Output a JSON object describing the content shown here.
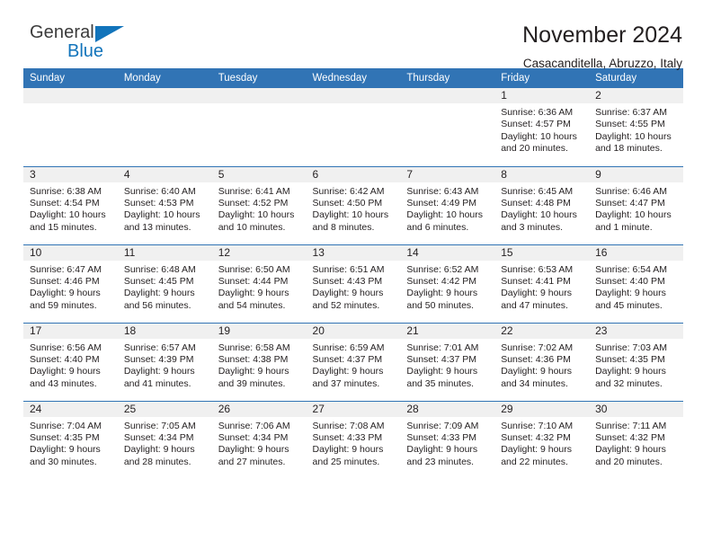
{
  "logo": {
    "word1": "General",
    "word2": "Blue",
    "triangle_icon": "blue-triangle-icon",
    "accent_color": "#1274bb"
  },
  "header": {
    "title": "November 2024",
    "subtitle": "Casacanditella, Abruzzo, Italy"
  },
  "colors": {
    "header_blue": "#3174b5",
    "daynum_bg": "#f0f0f0",
    "text": "#231f20"
  },
  "weekday_headers": [
    "Sunday",
    "Monday",
    "Tuesday",
    "Wednesday",
    "Thursday",
    "Friday",
    "Saturday"
  ],
  "weeks": [
    [
      {
        "day": "",
        "empty": true,
        "sunrise": "",
        "sunset": "",
        "daylight1": "",
        "daylight2": ""
      },
      {
        "day": "",
        "empty": true,
        "sunrise": "",
        "sunset": "",
        "daylight1": "",
        "daylight2": ""
      },
      {
        "day": "",
        "empty": true,
        "sunrise": "",
        "sunset": "",
        "daylight1": "",
        "daylight2": ""
      },
      {
        "day": "",
        "empty": true,
        "sunrise": "",
        "sunset": "",
        "daylight1": "",
        "daylight2": ""
      },
      {
        "day": "",
        "empty": true,
        "sunrise": "",
        "sunset": "",
        "daylight1": "",
        "daylight2": ""
      },
      {
        "day": "1",
        "empty": false,
        "sunrise": "Sunrise: 6:36 AM",
        "sunset": "Sunset: 4:57 PM",
        "daylight1": "Daylight: 10 hours",
        "daylight2": "and 20 minutes."
      },
      {
        "day": "2",
        "empty": false,
        "sunrise": "Sunrise: 6:37 AM",
        "sunset": "Sunset: 4:55 PM",
        "daylight1": "Daylight: 10 hours",
        "daylight2": "and 18 minutes."
      }
    ],
    [
      {
        "day": "3",
        "empty": false,
        "sunrise": "Sunrise: 6:38 AM",
        "sunset": "Sunset: 4:54 PM",
        "daylight1": "Daylight: 10 hours",
        "daylight2": "and 15 minutes."
      },
      {
        "day": "4",
        "empty": false,
        "sunrise": "Sunrise: 6:40 AM",
        "sunset": "Sunset: 4:53 PM",
        "daylight1": "Daylight: 10 hours",
        "daylight2": "and 13 minutes."
      },
      {
        "day": "5",
        "empty": false,
        "sunrise": "Sunrise: 6:41 AM",
        "sunset": "Sunset: 4:52 PM",
        "daylight1": "Daylight: 10 hours",
        "daylight2": "and 10 minutes."
      },
      {
        "day": "6",
        "empty": false,
        "sunrise": "Sunrise: 6:42 AM",
        "sunset": "Sunset: 4:50 PM",
        "daylight1": "Daylight: 10 hours",
        "daylight2": "and 8 minutes."
      },
      {
        "day": "7",
        "empty": false,
        "sunrise": "Sunrise: 6:43 AM",
        "sunset": "Sunset: 4:49 PM",
        "daylight1": "Daylight: 10 hours",
        "daylight2": "and 6 minutes."
      },
      {
        "day": "8",
        "empty": false,
        "sunrise": "Sunrise: 6:45 AM",
        "sunset": "Sunset: 4:48 PM",
        "daylight1": "Daylight: 10 hours",
        "daylight2": "and 3 minutes."
      },
      {
        "day": "9",
        "empty": false,
        "sunrise": "Sunrise: 6:46 AM",
        "sunset": "Sunset: 4:47 PM",
        "daylight1": "Daylight: 10 hours",
        "daylight2": "and 1 minute."
      }
    ],
    [
      {
        "day": "10",
        "empty": false,
        "sunrise": "Sunrise: 6:47 AM",
        "sunset": "Sunset: 4:46 PM",
        "daylight1": "Daylight: 9 hours",
        "daylight2": "and 59 minutes."
      },
      {
        "day": "11",
        "empty": false,
        "sunrise": "Sunrise: 6:48 AM",
        "sunset": "Sunset: 4:45 PM",
        "daylight1": "Daylight: 9 hours",
        "daylight2": "and 56 minutes."
      },
      {
        "day": "12",
        "empty": false,
        "sunrise": "Sunrise: 6:50 AM",
        "sunset": "Sunset: 4:44 PM",
        "daylight1": "Daylight: 9 hours",
        "daylight2": "and 54 minutes."
      },
      {
        "day": "13",
        "empty": false,
        "sunrise": "Sunrise: 6:51 AM",
        "sunset": "Sunset: 4:43 PM",
        "daylight1": "Daylight: 9 hours",
        "daylight2": "and 52 minutes."
      },
      {
        "day": "14",
        "empty": false,
        "sunrise": "Sunrise: 6:52 AM",
        "sunset": "Sunset: 4:42 PM",
        "daylight1": "Daylight: 9 hours",
        "daylight2": "and 50 minutes."
      },
      {
        "day": "15",
        "empty": false,
        "sunrise": "Sunrise: 6:53 AM",
        "sunset": "Sunset: 4:41 PM",
        "daylight1": "Daylight: 9 hours",
        "daylight2": "and 47 minutes."
      },
      {
        "day": "16",
        "empty": false,
        "sunrise": "Sunrise: 6:54 AM",
        "sunset": "Sunset: 4:40 PM",
        "daylight1": "Daylight: 9 hours",
        "daylight2": "and 45 minutes."
      }
    ],
    [
      {
        "day": "17",
        "empty": false,
        "sunrise": "Sunrise: 6:56 AM",
        "sunset": "Sunset: 4:40 PM",
        "daylight1": "Daylight: 9 hours",
        "daylight2": "and 43 minutes."
      },
      {
        "day": "18",
        "empty": false,
        "sunrise": "Sunrise: 6:57 AM",
        "sunset": "Sunset: 4:39 PM",
        "daylight1": "Daylight: 9 hours",
        "daylight2": "and 41 minutes."
      },
      {
        "day": "19",
        "empty": false,
        "sunrise": "Sunrise: 6:58 AM",
        "sunset": "Sunset: 4:38 PM",
        "daylight1": "Daylight: 9 hours",
        "daylight2": "and 39 minutes."
      },
      {
        "day": "20",
        "empty": false,
        "sunrise": "Sunrise: 6:59 AM",
        "sunset": "Sunset: 4:37 PM",
        "daylight1": "Daylight: 9 hours",
        "daylight2": "and 37 minutes."
      },
      {
        "day": "21",
        "empty": false,
        "sunrise": "Sunrise: 7:01 AM",
        "sunset": "Sunset: 4:37 PM",
        "daylight1": "Daylight: 9 hours",
        "daylight2": "and 35 minutes."
      },
      {
        "day": "22",
        "empty": false,
        "sunrise": "Sunrise: 7:02 AM",
        "sunset": "Sunset: 4:36 PM",
        "daylight1": "Daylight: 9 hours",
        "daylight2": "and 34 minutes."
      },
      {
        "day": "23",
        "empty": false,
        "sunrise": "Sunrise: 7:03 AM",
        "sunset": "Sunset: 4:35 PM",
        "daylight1": "Daylight: 9 hours",
        "daylight2": "and 32 minutes."
      }
    ],
    [
      {
        "day": "24",
        "empty": false,
        "sunrise": "Sunrise: 7:04 AM",
        "sunset": "Sunset: 4:35 PM",
        "daylight1": "Daylight: 9 hours",
        "daylight2": "and 30 minutes."
      },
      {
        "day": "25",
        "empty": false,
        "sunrise": "Sunrise: 7:05 AM",
        "sunset": "Sunset: 4:34 PM",
        "daylight1": "Daylight: 9 hours",
        "daylight2": "and 28 minutes."
      },
      {
        "day": "26",
        "empty": false,
        "sunrise": "Sunrise: 7:06 AM",
        "sunset": "Sunset: 4:34 PM",
        "daylight1": "Daylight: 9 hours",
        "daylight2": "and 27 minutes."
      },
      {
        "day": "27",
        "empty": false,
        "sunrise": "Sunrise: 7:08 AM",
        "sunset": "Sunset: 4:33 PM",
        "daylight1": "Daylight: 9 hours",
        "daylight2": "and 25 minutes."
      },
      {
        "day": "28",
        "empty": false,
        "sunrise": "Sunrise: 7:09 AM",
        "sunset": "Sunset: 4:33 PM",
        "daylight1": "Daylight: 9 hours",
        "daylight2": "and 23 minutes."
      },
      {
        "day": "29",
        "empty": false,
        "sunrise": "Sunrise: 7:10 AM",
        "sunset": "Sunset: 4:32 PM",
        "daylight1": "Daylight: 9 hours",
        "daylight2": "and 22 minutes."
      },
      {
        "day": "30",
        "empty": false,
        "sunrise": "Sunrise: 7:11 AM",
        "sunset": "Sunset: 4:32 PM",
        "daylight1": "Daylight: 9 hours",
        "daylight2": "and 20 minutes."
      }
    ]
  ]
}
